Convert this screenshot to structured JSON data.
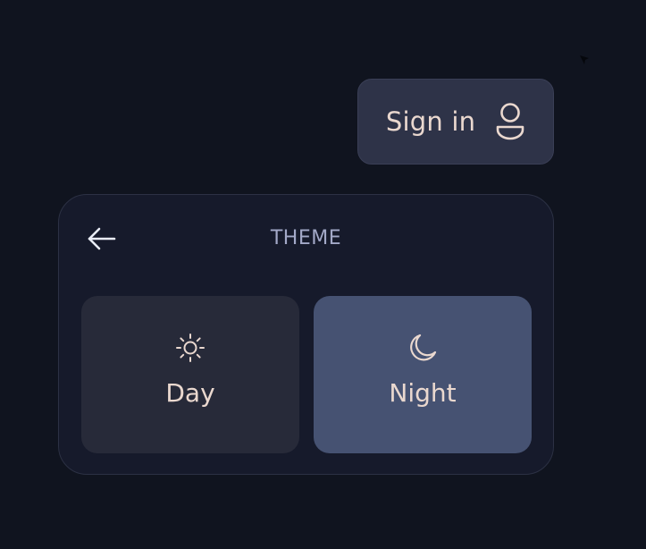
{
  "header": {
    "signin_label": "Sign in",
    "signin_icon": "user-icon"
  },
  "theme_panel": {
    "title": "THEME",
    "back_icon": "arrow-left-icon",
    "options": [
      {
        "label": "Day",
        "icon": "sun-icon",
        "selected": false
      },
      {
        "label": "Night",
        "icon": "moon-icon",
        "selected": true
      }
    ]
  },
  "colors": {
    "background": "#10141f",
    "panel": "#161a2b",
    "signin_button": "#2e3348",
    "option_default": "#272a39",
    "option_selected": "#465272",
    "text": "#ead8cf",
    "title_text": "#a3a9c8"
  }
}
